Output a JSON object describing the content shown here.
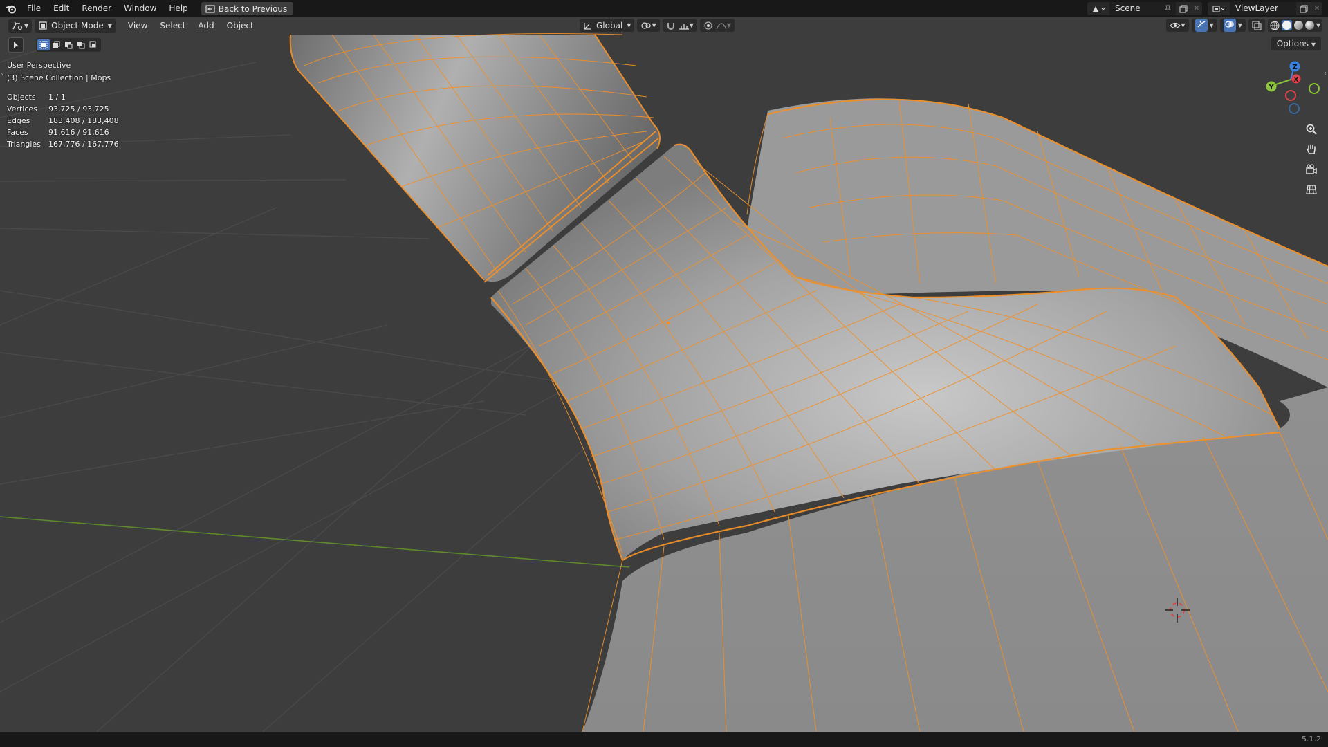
{
  "menubar": {
    "items": [
      "File",
      "Edit",
      "Render",
      "Window",
      "Help"
    ],
    "back_button": "Back to Previous",
    "scene_label": "Scene",
    "viewlayer_label": "ViewLayer"
  },
  "header": {
    "mode": "Object Mode",
    "menus": [
      "View",
      "Select",
      "Add",
      "Object"
    ],
    "transform_orientation": "Global",
    "options": "Options"
  },
  "overlay": {
    "view_name": "User Perspective",
    "collection": "(3) Scene Collection | Mops",
    "stats": [
      {
        "label": "Objects",
        "value": "1 / 1"
      },
      {
        "label": "Vertices",
        "value": "93,725 / 93,725"
      },
      {
        "label": "Edges",
        "value": "183,408 / 183,408"
      },
      {
        "label": "Faces",
        "value": "91,616 / 91,616"
      },
      {
        "label": "Triangles",
        "value": "167,776 / 167,776"
      }
    ]
  },
  "gizmo": {
    "x": "X",
    "y": "Y",
    "z": "Z"
  },
  "status": {
    "version": "5.1.2"
  },
  "colors": {
    "wire": "#f0902a",
    "axis_x": "#e2414e",
    "axis_y": "#8bc33e",
    "axis_z": "#3b83e0",
    "bg": "#3d3d3d",
    "mesh": "#8f8f8f"
  }
}
